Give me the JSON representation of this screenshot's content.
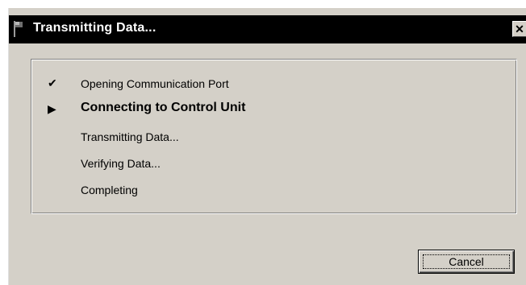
{
  "window": {
    "title": "Transmitting Data...",
    "close_glyph": "✕",
    "title_icon": "flag-icon"
  },
  "steps": [
    {
      "label": "Opening Communication Port",
      "status": "done",
      "marker": "✔"
    },
    {
      "label": "Connecting to Control Unit",
      "status": "current",
      "marker": "▶"
    },
    {
      "label": "Transmitting Data...",
      "status": "pending",
      "marker": ""
    },
    {
      "label": "Verifying Data...",
      "status": "pending",
      "marker": ""
    },
    {
      "label": "Completing",
      "status": "pending",
      "marker": ""
    }
  ],
  "buttons": {
    "cancel_label": "Cancel"
  },
  "colors": {
    "titlebar": "#000000",
    "face": "#d4d0c8"
  }
}
